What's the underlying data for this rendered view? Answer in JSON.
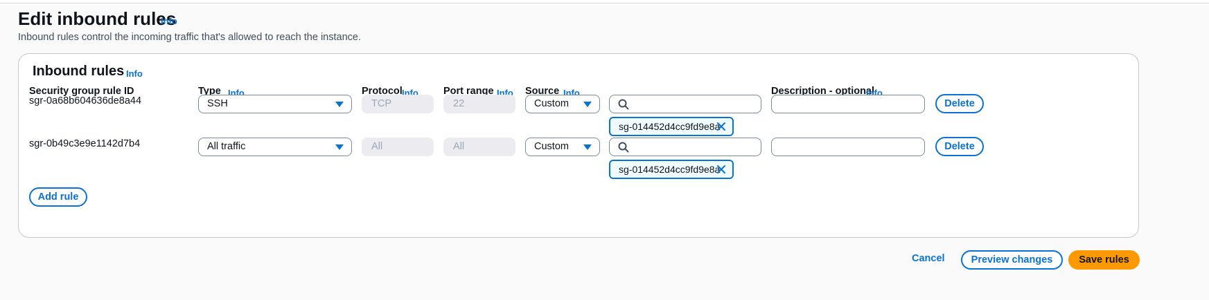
{
  "page": {
    "title": "Edit inbound rules",
    "info": "Info",
    "description": "Inbound rules control the incoming traffic that's allowed to reach the instance."
  },
  "panel": {
    "title": "Inbound rules",
    "info": "Info",
    "columns": {
      "rule_id": "Security group rule ID",
      "type": "Type",
      "protocol": "Protocol",
      "port_range": "Port range",
      "source": "Source",
      "description": "Description - optional",
      "info": "Info"
    }
  },
  "rules": [
    {
      "id": "sgr-0a68b604636de8a44",
      "type": "SSH",
      "protocol": "TCP",
      "port_range": "22",
      "source": "Custom",
      "search_value": "",
      "token": "sg-014452d4cc9fd9e8a",
      "description_value": "",
      "delete_label": "Delete"
    },
    {
      "id": "sgr-0b49c3e9e1142d7b4",
      "type": "All traffic",
      "protocol": "All",
      "port_range": "All",
      "source": "Custom",
      "search_value": "",
      "token": "sg-014452d4cc9fd9e8a",
      "description_value": "",
      "delete_label": "Delete"
    }
  ],
  "actions": {
    "add_rule": "Add rule",
    "cancel": "Cancel",
    "preview": "Preview changes",
    "save": "Save rules"
  },
  "colors": {
    "accent": "#0972d3",
    "primary_button": "#ff9900",
    "disabled_bg": "#ebebf0"
  },
  "icons": [
    "search-icon",
    "dropdown-caret-icon",
    "remove-token-icon"
  ]
}
